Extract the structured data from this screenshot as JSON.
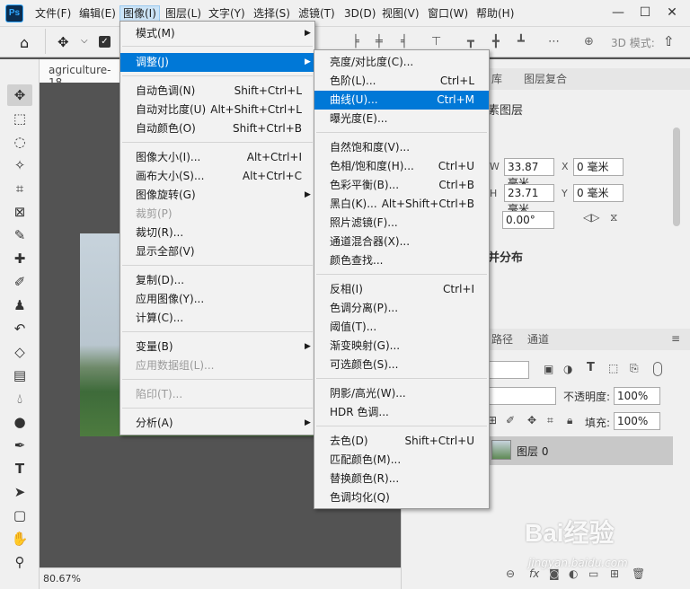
{
  "app": {
    "logo": "Ps"
  },
  "menubar": {
    "items": [
      "文件(F)",
      "编辑(E)",
      "图像(I)",
      "图层(L)",
      "文字(Y)",
      "选择(S)",
      "滤镜(T)",
      "3D(D)",
      "视图(V)",
      "窗口(W)",
      "帮助(H)"
    ],
    "window_buttons": [
      "—",
      "☐",
      "✕"
    ]
  },
  "options_bar": {
    "mode_3d": "3D 模式:"
  },
  "document": {
    "tab_title": "agriculture-18",
    "zoom": "80.67%"
  },
  "image_menu": {
    "items": [
      {
        "label": "模式(M)",
        "shortcut": "",
        "submenu": true
      },
      {
        "label": "调整(J)",
        "shortcut": "",
        "submenu": true,
        "highlight": true
      },
      {
        "label": "自动色调(N)",
        "shortcut": "Shift+Ctrl+L"
      },
      {
        "label": "自动对比度(U)",
        "shortcut": "Alt+Shift+Ctrl+L"
      },
      {
        "label": "自动颜色(O)",
        "shortcut": "Shift+Ctrl+B"
      },
      {
        "label": "图像大小(I)...",
        "shortcut": "Alt+Ctrl+I"
      },
      {
        "label": "画布大小(S)...",
        "shortcut": "Alt+Ctrl+C"
      },
      {
        "label": "图像旋转(G)",
        "shortcut": "",
        "submenu": true
      },
      {
        "label": "裁剪(P)",
        "shortcut": "",
        "disabled": true
      },
      {
        "label": "裁切(R)...",
        "shortcut": ""
      },
      {
        "label": "显示全部(V)",
        "shortcut": ""
      },
      {
        "label": "复制(D)...",
        "shortcut": ""
      },
      {
        "label": "应用图像(Y)...",
        "shortcut": ""
      },
      {
        "label": "计算(C)...",
        "shortcut": ""
      },
      {
        "label": "变量(B)",
        "shortcut": "",
        "submenu": true
      },
      {
        "label": "应用数据组(L)...",
        "shortcut": "",
        "disabled": true
      },
      {
        "label": "陷印(T)...",
        "shortcut": "",
        "disabled": true
      },
      {
        "label": "分析(A)",
        "shortcut": "",
        "submenu": true
      }
    ]
  },
  "adjust_menu": {
    "items": [
      {
        "label": "亮度/对比度(C)...",
        "shortcut": ""
      },
      {
        "label": "色阶(L)...",
        "shortcut": "Ctrl+L"
      },
      {
        "label": "曲线(U)...",
        "shortcut": "Ctrl+M",
        "highlight": true
      },
      {
        "label": "曝光度(E)...",
        "shortcut": ""
      },
      {
        "label": "自然饱和度(V)...",
        "shortcut": ""
      },
      {
        "label": "色相/饱和度(H)...",
        "shortcut": "Ctrl+U"
      },
      {
        "label": "色彩平衡(B)...",
        "shortcut": "Ctrl+B"
      },
      {
        "label": "黑白(K)...",
        "shortcut": "Alt+Shift+Ctrl+B"
      },
      {
        "label": "照片滤镜(F)...",
        "shortcut": ""
      },
      {
        "label": "通道混合器(X)...",
        "shortcut": ""
      },
      {
        "label": "颜色查找...",
        "shortcut": ""
      },
      {
        "label": "反相(I)",
        "shortcut": "Ctrl+I"
      },
      {
        "label": "色调分离(P)...",
        "shortcut": ""
      },
      {
        "label": "阈值(T)...",
        "shortcut": ""
      },
      {
        "label": "渐变映射(G)...",
        "shortcut": ""
      },
      {
        "label": "可选颜色(S)...",
        "shortcut": ""
      },
      {
        "label": "阴影/高光(W)...",
        "shortcut": ""
      },
      {
        "label": "HDR 色调...",
        "shortcut": ""
      },
      {
        "label": "去色(D)",
        "shortcut": "Shift+Ctrl+U"
      },
      {
        "label": "匹配颜色(M)...",
        "shortcut": ""
      },
      {
        "label": "替换颜色(R)...",
        "shortcut": ""
      },
      {
        "label": "色调均化(Q)",
        "shortcut": ""
      }
    ]
  },
  "properties_panel": {
    "tabs": [
      "库",
      "图层复合"
    ],
    "section_title": "素图层",
    "w_label": "W",
    "w_value": "33.87 毫米",
    "h_label": "H",
    "h_value": "23.71 毫米",
    "x_label": "X",
    "x_value": "0 毫米",
    "y_label": "Y",
    "y_value": "0 毫米",
    "angle_value": "0.00°",
    "distribute_title": "并分布"
  },
  "layers_panel": {
    "tabs": [
      "路径",
      "通道"
    ],
    "opacity_label": "不透明度:",
    "opacity_value": "100%",
    "fill_label": "填充:",
    "fill_value": "100%",
    "layer_name": "图层 0"
  },
  "watermark": {
    "text": "Bai经验",
    "url": "jingyan.baidu.com"
  }
}
